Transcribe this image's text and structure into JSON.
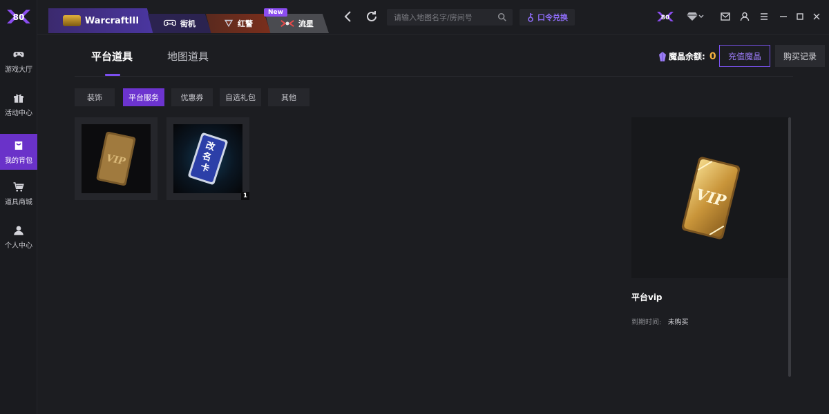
{
  "colors": {
    "accent": "#6c34cf",
    "accent_text": "#8d6cf5",
    "balance": "#f5b23e",
    "bg": "#1c1d21"
  },
  "brand": {
    "logo_text": "80"
  },
  "sidebar": {
    "items": [
      {
        "label": "游戏大厅",
        "icon": "gamepad-icon"
      },
      {
        "label": "活动中心",
        "icon": "gift-icon"
      },
      {
        "label": "我的背包",
        "icon": "backpack-icon",
        "active": true
      },
      {
        "label": "道具商城",
        "icon": "cart-icon"
      },
      {
        "label": "个人中心",
        "icon": "user-icon"
      }
    ]
  },
  "topbar": {
    "game_tabs": [
      {
        "label": "WarcraftIII"
      },
      {
        "label": "街机"
      },
      {
        "label": "红警"
      },
      {
        "label": "流星"
      }
    ],
    "new_badge": "New",
    "search_placeholder": "请输入地图名字/房间号",
    "redeem_label": "口令兑换",
    "profile_badge": "80"
  },
  "main": {
    "tabs": [
      {
        "label": "平台道具",
        "active": true
      },
      {
        "label": "地图道具"
      }
    ],
    "balance_label": "魔晶余额:",
    "balance_value": "0",
    "recharge_label": "充值魔晶",
    "history_label": "购买记录",
    "subtabs": [
      {
        "label": "装饰"
      },
      {
        "label": "平台服务",
        "active": true
      },
      {
        "label": "优惠券"
      },
      {
        "label": "自选礼包"
      },
      {
        "label": "其他"
      }
    ],
    "items": [
      {
        "name": "vip-card",
        "card_text": "VIP",
        "count": ""
      },
      {
        "name": "rename-card",
        "card_text": "改名卡",
        "count": "1"
      }
    ]
  },
  "detail": {
    "card_text": "VIP",
    "name": "平台vip",
    "expire_label": "到期时间:",
    "expire_value": "未购买"
  }
}
